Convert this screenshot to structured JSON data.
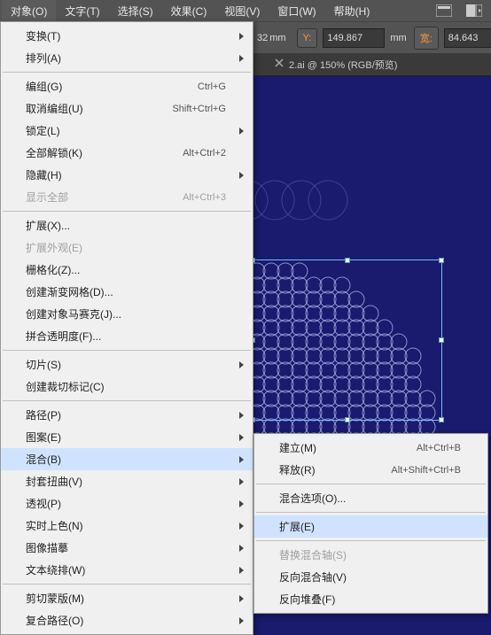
{
  "menubar": {
    "items": [
      "对象(O)",
      "文字(T)",
      "选择(S)",
      "效果(C)",
      "视图(V)",
      "窗口(W)",
      "帮助(H)"
    ]
  },
  "toolbar": {
    "unit_mm": "mm",
    "y_label": "Y:",
    "y_value": "149.867",
    "w_label": "宽:",
    "w_value": "84.643",
    "x_extra": "32"
  },
  "tabbar": {
    "tab_title": "2.ai @ 150% (RGB/预览)"
  },
  "main_menu": [
    {
      "type": "item",
      "label": "变换(T)",
      "submenu": true
    },
    {
      "type": "item",
      "label": "排列(A)",
      "submenu": true
    },
    {
      "type": "sep"
    },
    {
      "type": "item",
      "label": "编组(G)",
      "shortcut": "Ctrl+G"
    },
    {
      "type": "item",
      "label": "取消编组(U)",
      "shortcut": "Shift+Ctrl+G"
    },
    {
      "type": "item",
      "label": "锁定(L)",
      "submenu": true
    },
    {
      "type": "item",
      "label": "全部解锁(K)",
      "shortcut": "Alt+Ctrl+2"
    },
    {
      "type": "item",
      "label": "隐藏(H)",
      "submenu": true
    },
    {
      "type": "item",
      "label": "显示全部",
      "shortcut": "Alt+Ctrl+3",
      "disabled": true
    },
    {
      "type": "sep"
    },
    {
      "type": "item",
      "label": "扩展(X)..."
    },
    {
      "type": "item",
      "label": "扩展外观(E)",
      "disabled": true
    },
    {
      "type": "item",
      "label": "栅格化(Z)..."
    },
    {
      "type": "item",
      "label": "创建渐变网格(D)..."
    },
    {
      "type": "item",
      "label": "创建对象马赛克(J)..."
    },
    {
      "type": "item",
      "label": "拼合透明度(F)..."
    },
    {
      "type": "sep"
    },
    {
      "type": "item",
      "label": "切片(S)",
      "submenu": true
    },
    {
      "type": "item",
      "label": "创建裁切标记(C)"
    },
    {
      "type": "sep"
    },
    {
      "type": "item",
      "label": "路径(P)",
      "submenu": true
    },
    {
      "type": "item",
      "label": "图案(E)",
      "submenu": true
    },
    {
      "type": "item",
      "label": "混合(B)",
      "submenu": true,
      "highlighted": true
    },
    {
      "type": "item",
      "label": "封套扭曲(V)",
      "submenu": true
    },
    {
      "type": "item",
      "label": "透视(P)",
      "submenu": true
    },
    {
      "type": "item",
      "label": "实时上色(N)",
      "submenu": true
    },
    {
      "type": "item",
      "label": "图像描摹",
      "submenu": true
    },
    {
      "type": "item",
      "label": "文本绕排(W)",
      "submenu": true
    },
    {
      "type": "sep"
    },
    {
      "type": "item",
      "label": "剪切蒙版(M)",
      "submenu": true
    },
    {
      "type": "item",
      "label": "复合路径(O)",
      "submenu": true
    }
  ],
  "submenu_blend": [
    {
      "type": "item",
      "label": "建立(M)",
      "shortcut": "Alt+Ctrl+B"
    },
    {
      "type": "item",
      "label": "释放(R)",
      "shortcut": "Alt+Shift+Ctrl+B"
    },
    {
      "type": "sep"
    },
    {
      "type": "item",
      "label": "混合选项(O)..."
    },
    {
      "type": "sep"
    },
    {
      "type": "item",
      "label": "扩展(E)",
      "highlighted": true
    },
    {
      "type": "sep"
    },
    {
      "type": "item",
      "label": "替换混合轴(S)",
      "disabled": true
    },
    {
      "type": "item",
      "label": "反向混合轴(V)"
    },
    {
      "type": "item",
      "label": "反向堆叠(F)"
    }
  ]
}
